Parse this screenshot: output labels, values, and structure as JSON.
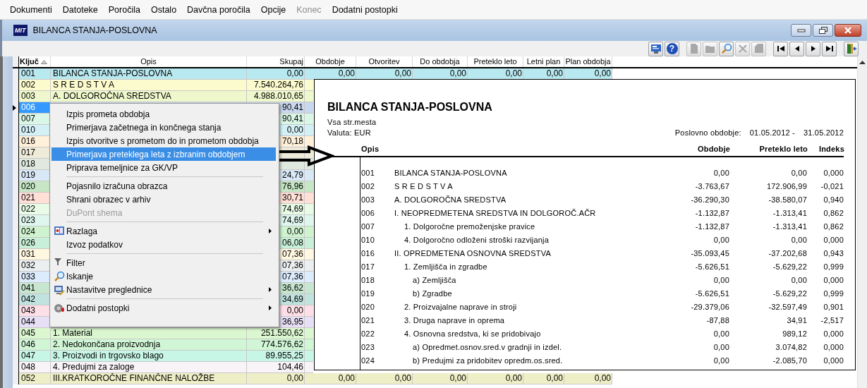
{
  "menu_bar": [
    {
      "label": "Dokumenti",
      "disabled": false
    },
    {
      "label": "Datoteke",
      "disabled": false
    },
    {
      "label": "Poročila",
      "disabled": false
    },
    {
      "label": "Ostalo",
      "disabled": false
    },
    {
      "label": "Davčna poročila",
      "disabled": false
    },
    {
      "label": "Opcije",
      "disabled": false
    },
    {
      "label": "Konec",
      "disabled": true
    },
    {
      "label": "Dodatni postopki",
      "disabled": false
    }
  ],
  "window": {
    "logo": "MIT",
    "title": "BILANCA STANJA-POSLOVNA"
  },
  "toolbar": [
    [
      {
        "kind": "display",
        "disabled": false
      },
      {
        "kind": "help",
        "label": "?",
        "disabled": false
      }
    ],
    [
      {
        "kind": "new",
        "disabled": true
      },
      {
        "kind": "open",
        "disabled": true
      },
      {
        "kind": "search",
        "disabled": false
      },
      {
        "kind": "delete",
        "disabled": true
      },
      {
        "kind": "save",
        "disabled": true
      }
    ],
    [
      {
        "kind": "first",
        "disabled": false
      },
      {
        "kind": "prev",
        "disabled": false
      },
      {
        "kind": "next",
        "disabled": false
      },
      {
        "kind": "last",
        "disabled": false
      }
    ],
    [
      {
        "kind": "exit",
        "disabled": false
      }
    ]
  ],
  "table": {
    "columns": [
      {
        "label": "Ključ",
        "sorted": true
      },
      {
        "label": "Opis",
        "sorted": false
      },
      {
        "label": "Skupaj",
        "sorted": false
      },
      {
        "label": "Obdobje",
        "sorted": false
      },
      {
        "label": "Otvoritev",
        "sorted": false
      },
      {
        "label": "Do obdobja",
        "sorted": false
      },
      {
        "label": "Preteklo leto",
        "sorted": false
      },
      {
        "label": "Letni plan",
        "sorted": false
      },
      {
        "label": "Plan obdobja",
        "sorted": false
      }
    ],
    "rows": [
      {
        "key": "001",
        "opis": "BILANCA STANJA-POSLOVNA",
        "skupaj": "0,00",
        "values": [
          "0,00",
          "0,00",
          "0,00",
          "0,00",
          "0,00",
          "0,00"
        ],
        "color": "#b9e9f0",
        "selected": false
      },
      {
        "key": "002",
        "opis": "S R E D S T V A",
        "skupaj": "7.540.264,76",
        "color": "#fbfbcd",
        "selected": false
      },
      {
        "key": "003",
        "opis": "A. DOLGOROČNA SREDSTVA",
        "skupaj": "4.988.010,65",
        "color": "#eef8cc",
        "selected": false
      },
      {
        "key": "006",
        "skupaj": "90,41",
        "color": "#c9d8ee",
        "selected": true
      },
      {
        "key": "007",
        "skupaj": "90,41",
        "color": "#d9f6e6",
        "selected": false
      },
      {
        "key": "010",
        "skupaj": "0,00",
        "color": "#d3f0f7",
        "selected": false
      },
      {
        "key": "016",
        "skupaj": "70,18",
        "color": "#fff0d9",
        "selected": false
      },
      {
        "key": "017",
        "color": "#efebd9",
        "selected": false
      },
      {
        "key": "018",
        "color": "#dfe9df",
        "selected": false
      },
      {
        "key": "019",
        "skupaj": "24,79",
        "color": "#d9e8f6",
        "selected": false
      },
      {
        "key": "020",
        "skupaj": "76,96",
        "color": "#c6e6c6",
        "selected": false
      },
      {
        "key": "021",
        "skupaj": "30,71",
        "color": "#ffdfd6",
        "selected": false
      },
      {
        "key": "022",
        "skupaj": "74,69",
        "color": "#e7fbe7",
        "selected": false
      },
      {
        "key": "023",
        "skupaj": "74,69",
        "color": "#def6ee",
        "selected": false
      },
      {
        "key": "024",
        "skupaj": "0,00",
        "color": "#cff3cf",
        "selected": false
      },
      {
        "key": "026",
        "skupaj": "06,08",
        "color": "#c8efd7",
        "selected": false
      },
      {
        "key": "031",
        "skupaj": "07,36",
        "color": "#fff7df",
        "selected": false
      },
      {
        "key": "032",
        "skupaj": "07,36",
        "color": "#eceff0",
        "selected": false
      },
      {
        "key": "033",
        "skupaj": "07,36",
        "color": "#dcecfd",
        "selected": false
      },
      {
        "key": "041",
        "skupaj": "36,62",
        "color": "#c7e6cf",
        "selected": false
      },
      {
        "key": "042",
        "skupaj": "34,69",
        "color": "#c1e3df",
        "selected": false
      },
      {
        "key": "043",
        "skupaj": "0,00",
        "color": "#ffdfe7",
        "selected": false
      },
      {
        "key": "044",
        "skupaj": "36,95",
        "color": "#e6dff6",
        "selected": false
      },
      {
        "key": "045",
        "opis": "1. Material",
        "skupaj": "251.550,62",
        "color": "#dbf7cf",
        "selected": false
      },
      {
        "key": "046",
        "opis": "2. Nedokončana proizvodnja",
        "skupaj": "774.576,62",
        "color": "#d0f6d6",
        "selected": false
      },
      {
        "key": "047",
        "opis": "3. Proizvodi in trgovsko blago",
        "skupaj": "89.955,25",
        "color": "#c8f6e6",
        "selected": false
      },
      {
        "key": "048",
        "opis": "4. Predujmi za zaloge",
        "skupaj": "104,46",
        "color": "#f8f3f7",
        "selected": false
      },
      {
        "key": "052",
        "opis": "III.KRATKOROČNE FINANČNE NALOŽBE",
        "skupaj": "0,00",
        "values": [
          "0,00",
          "0,00",
          "0,00",
          "0,00",
          "0,00",
          "0,00"
        ],
        "color": "#efefc7",
        "selected": false
      }
    ]
  },
  "context_menu": [
    {
      "kind": "plain",
      "label": "Izpis prometa obdobja",
      "disabled": false,
      "submenu": false,
      "selected": false
    },
    {
      "kind": "plain",
      "label": "Primerjava začetnega in končnega stanja",
      "disabled": false,
      "submenu": false,
      "selected": false
    },
    {
      "kind": "plain",
      "label": "Izpis otvoritve s prometom do in prometom obdobja",
      "disabled": false,
      "submenu": false,
      "selected": false
    },
    {
      "kind": "plain",
      "label": "Primerjava preteklega leta z izbranim obdobjem",
      "disabled": false,
      "submenu": false,
      "selected": true
    },
    {
      "kind": "plain",
      "label": "Priprava temeljnice za GK/VP",
      "disabled": false,
      "submenu": false,
      "selected": false
    },
    {
      "kind": "separator"
    },
    {
      "kind": "plain",
      "label": "Pojasnilo izračuna obrazca",
      "disabled": false,
      "submenu": false,
      "selected": false
    },
    {
      "kind": "plain",
      "label": "Shrani obrazec v arhiv",
      "disabled": false,
      "submenu": false,
      "selected": false
    },
    {
      "kind": "plain",
      "label": "DuPont shema",
      "disabled": true,
      "submenu": false,
      "selected": false
    },
    {
      "kind": "separator"
    },
    {
      "kind": "help",
      "label": "Razlaga",
      "disabled": false,
      "submenu": true,
      "selected": false
    },
    {
      "kind": "plain",
      "label": "Izvoz podatkov",
      "disabled": false,
      "submenu": false,
      "selected": false
    },
    {
      "kind": "separator"
    },
    {
      "kind": "filter",
      "label": "Filter",
      "disabled": false,
      "submenu": false,
      "selected": false
    },
    {
      "kind": "search",
      "label": "Iskanje",
      "disabled": false,
      "submenu": false,
      "selected": false
    },
    {
      "kind": "settings",
      "label": "Nastavitve preglednice",
      "disabled": false,
      "submenu": true,
      "selected": false
    },
    {
      "kind": "separator"
    },
    {
      "kind": "extras",
      "label": "Dodatni postopki",
      "disabled": false,
      "submenu": true,
      "selected": false
    }
  ],
  "report": {
    "title": "BILANCA STANJA-POSLOVNA",
    "subtitle": "Vsa str.mesta",
    "currency": "Valuta: EUR",
    "period_label": "Poslovno obdobje:",
    "period_from": "01.05.2012 -",
    "period_to": "31.05.2012",
    "columns": [
      "Opis",
      "Obdobje",
      "Preteklo leto",
      "Indeks"
    ],
    "rows": [
      {
        "code": "001",
        "label": "BILANCA STANJA-POSLOVNA",
        "obdobje": "0,00",
        "preteklo_leto": "0,00",
        "indeks": "0,000"
      },
      {
        "code": "002",
        "label": "S R E D S T V A",
        "obdobje": "-3.763,67",
        "preteklo_leto": "172.906,99",
        "indeks": "-0,021"
      },
      {
        "code": "003",
        "label": "A. DOLGOROČNA SREDSTVA",
        "obdobje": "-36.290,30",
        "preteklo_leto": "-38.580,07",
        "indeks": "0,940"
      },
      {
        "code": "006",
        "label": "I.  NEOPREDMETENA SREDSTVA IN DOLGOROČ.AČR",
        "obdobje": "-1.132,87",
        "preteklo_leto": "-1.313,41",
        "indeks": "0,862",
        "children": [
          {
            "code": "007",
            "label": "1. Dolgoročne premoženjske pravice",
            "obdobje": "-1.132,87",
            "preteklo_leto": "-1.313,41",
            "indeks": "0,862"
          },
          {
            "code": "010",
            "label": "4. Dolgoročno odloženi stroški razvijanja",
            "obdobje": "0,00",
            "preteklo_leto": "0,00",
            "indeks": "0,000"
          }
        ]
      },
      {
        "code": "016",
        "label": "II. OPREDMETENA OSNOVNA SREDSTVA",
        "obdobje": "-35.093,45",
        "preteklo_leto": "-37.202,68",
        "indeks": "0,943",
        "children": [
          {
            "code": "017",
            "label": "1. Zemljišča in zgradbe",
            "obdobje": "-5.626,51",
            "preteklo_leto": "-5.629,22",
            "indeks": "0,999",
            "children": [
              {
                "code": "018",
                "label": "a) Zemljišča",
                "obdobje": "0,00",
                "preteklo_leto": "0,00",
                "indeks": "0,000"
              },
              {
                "code": "019",
                "label": "b) Zgradbe",
                "obdobje": "-5.626,51",
                "preteklo_leto": "-5.629,22",
                "indeks": "0,999"
              }
            ]
          },
          {
            "code": "020",
            "label": "2. Proizvajalne naprave in stroji",
            "obdobje": "-29.379,06",
            "preteklo_leto": "-32.597,49",
            "indeks": "0,901"
          },
          {
            "code": "021",
            "label": "3. Druga naprave in oprema",
            "obdobje": "-87,88",
            "preteklo_leto": "34,91",
            "indeks": "-2,517"
          },
          {
            "code": "022",
            "label": "4. Osnovna sredstva, ki se pridobivajo",
            "obdobje": "0,00",
            "preteklo_leto": "989,12",
            "indeks": "0,000",
            "children": [
              {
                "code": "023",
                "label": "a) Opredmet.osnov.sred.v gradnji in izdel.",
                "obdobje": "0,00",
                "preteklo_leto": "3.074,82",
                "indeks": "0,000"
              },
              {
                "code": "024",
                "label": "b) Predujmi za pridobitev opredm.os.sred.",
                "obdobje": "0,00",
                "preteklo_leto": "-2.085,70",
                "indeks": "0,000"
              }
            ]
          }
        ]
      }
    ]
  }
}
